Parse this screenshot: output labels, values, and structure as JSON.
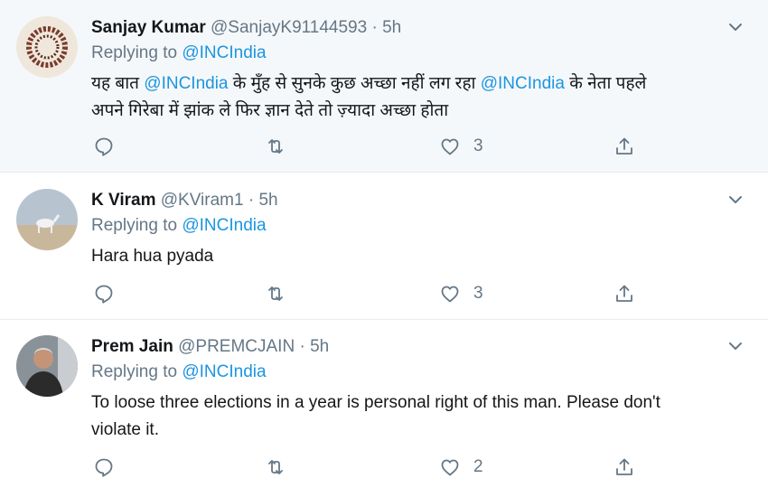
{
  "tweets": [
    {
      "name": "Sanjay Kumar",
      "handle": "@SanjayK91144593",
      "sep": "·",
      "time": "5h",
      "replying_prefix": "Replying to ",
      "replying_to": "@INCIndia",
      "text_line1_a": "यह बात ",
      "text_line1_mention1": "@INCIndia",
      "text_line1_b": " के मुँह से सुनके कुछ अच्छा नहीं लग रहा ",
      "text_line1_mention2": "@INCIndia",
      "text_line1_c": " के नेता पहले",
      "text_line2": "अपने गिरेबा में झांक ले फिर ज्ञान देते तो ज़्यादा अच्छा होता",
      "likes": "3"
    },
    {
      "name": "K Viram",
      "handle": "@KViram1",
      "sep": "·",
      "time": "5h",
      "replying_prefix": "Replying to ",
      "replying_to": "@INCIndia",
      "text": "Hara hua pyada",
      "likes": "3"
    },
    {
      "name": "Prem Jain",
      "handle": "@PREMCJAIN",
      "sep": "·",
      "time": "5h",
      "replying_prefix": "Replying to ",
      "replying_to": "@INCIndia",
      "text_line1": "To loose three elections in a year is personal right of this man. Please don't",
      "text_line2": "violate it.",
      "likes": "2"
    }
  ],
  "colors": {
    "link": "#1b95e0",
    "muted": "#657786",
    "highlight_bg": "#f5f8fa"
  }
}
